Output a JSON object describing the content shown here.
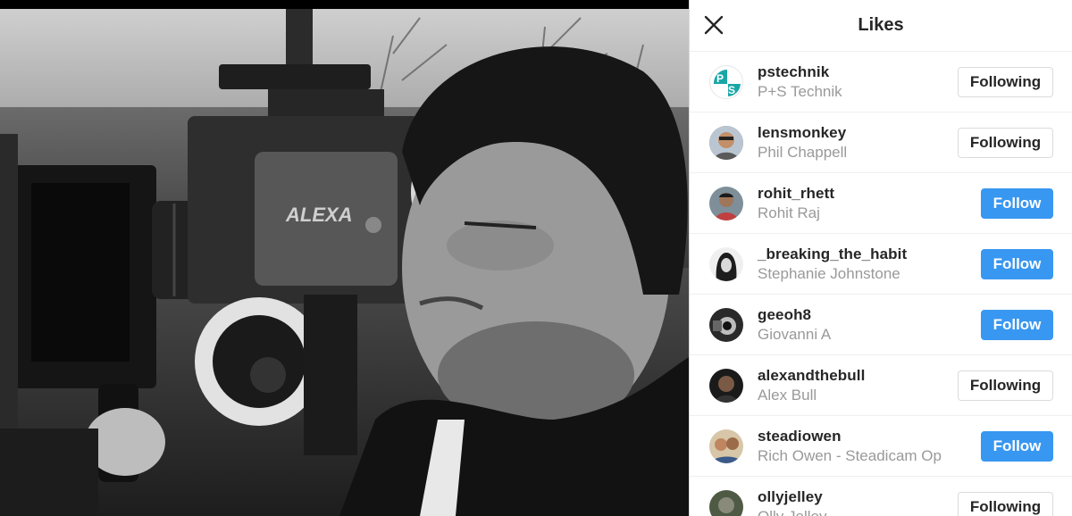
{
  "panel": {
    "title": "Likes"
  },
  "likes": [
    {
      "username": "pstechnik",
      "fullname": "P+S Technik",
      "button": "Following",
      "state": "following",
      "avatar": "ps-logo",
      "color": "#1aa6a6"
    },
    {
      "username": "lensmonkey",
      "fullname": "Phil Chappell",
      "button": "Following",
      "state": "following",
      "avatar": "person",
      "color": "#8a6a4a"
    },
    {
      "username": "rohit_rhett",
      "fullname": "Rohit Raj",
      "button": "Follow",
      "state": "follow",
      "avatar": "person",
      "color": "#6a7a8a"
    },
    {
      "username": "_breaking_the_habit",
      "fullname": "Stephanie Johnstone",
      "button": "Follow",
      "state": "follow",
      "avatar": "person",
      "color": "#3a3a3a"
    },
    {
      "username": "geeoh8",
      "fullname": "Giovanni A",
      "button": "Follow",
      "state": "follow",
      "avatar": "person",
      "color": "#2a2a2a"
    },
    {
      "username": "alexandthebull",
      "fullname": "Alex Bull",
      "button": "Following",
      "state": "following",
      "avatar": "person",
      "color": "#4a3a30"
    },
    {
      "username": "steadiowen",
      "fullname": "Rich Owen - Steadicam Op",
      "button": "Follow",
      "state": "follow",
      "avatar": "person",
      "color": "#9a6a4a"
    },
    {
      "username": "ollyjelley",
      "fullname": "Olly Jelley",
      "button": "Following",
      "state": "following",
      "avatar": "person",
      "color": "#5a6a4a"
    }
  ],
  "colors": {
    "follow_blue": "#3897f0",
    "text_dark": "#262626",
    "text_muted": "#999999",
    "border": "#dbdbdb"
  },
  "icons": {
    "close": "close-icon"
  }
}
